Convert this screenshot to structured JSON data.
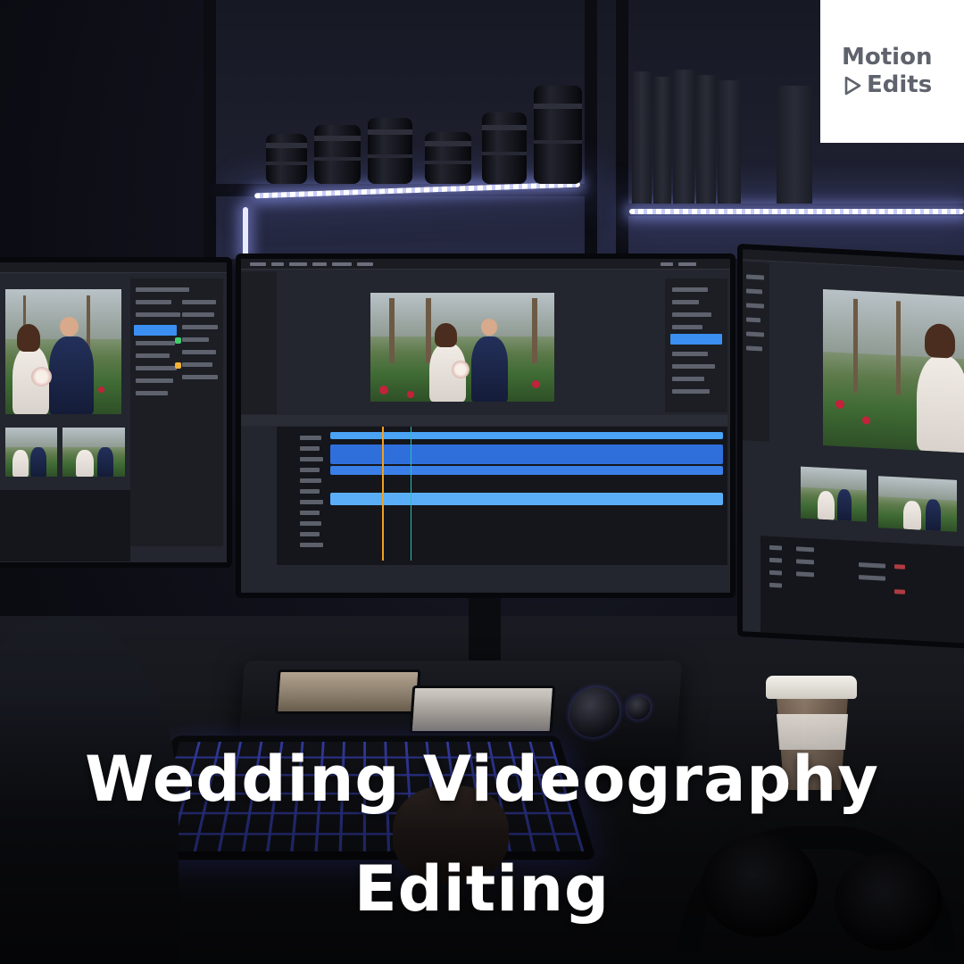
{
  "logo": {
    "line1": "Motion",
    "line2": "Edits",
    "color": "#5f636d"
  },
  "headline": {
    "line1": "Wedding Videography",
    "line2": "Editing"
  },
  "colors": {
    "accent_track": "#3b8ff0",
    "playhead": "#f0a020",
    "led_glow": "#c9cdfa"
  }
}
